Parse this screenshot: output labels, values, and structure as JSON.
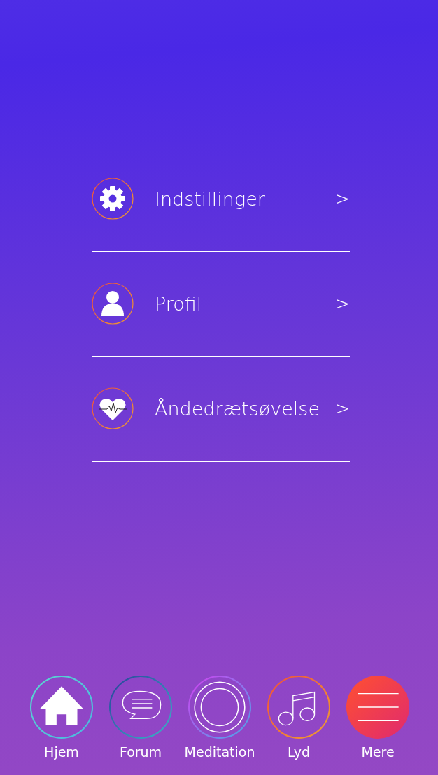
{
  "menu": [
    {
      "kind": "gear",
      "label": "Indstillinger",
      "chevron": ">"
    },
    {
      "kind": "person",
      "label": "Profil",
      "chevron": ">"
    },
    {
      "kind": "heart",
      "label": "Åndedrætsøvelse",
      "chevron": ">"
    }
  ],
  "tab_bar": [
    {
      "kind": "home",
      "label": "Hjem",
      "selected": false
    },
    {
      "kind": "forum",
      "label": "Forum",
      "selected": false
    },
    {
      "kind": "meditation",
      "label": "Meditation",
      "selected": false
    },
    {
      "kind": "music",
      "label": "Lyd",
      "selected": false
    },
    {
      "kind": "more",
      "label": "Mere",
      "selected": true
    }
  ]
}
